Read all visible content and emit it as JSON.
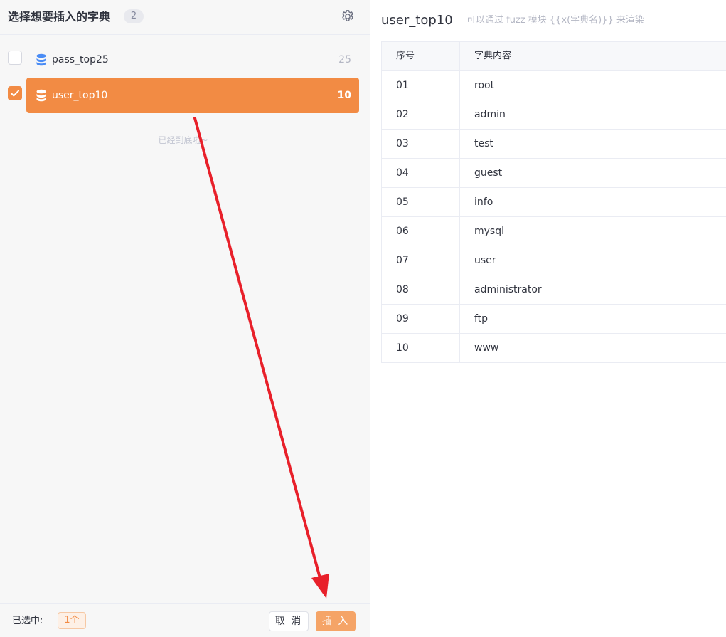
{
  "left_panel": {
    "title": "选择想要插入的字典",
    "count": "2",
    "settings_icon": "gear-icon",
    "items": [
      {
        "name": "pass_top25",
        "count": "25",
        "checked": false,
        "icon": "database-icon"
      },
      {
        "name": "user_top10",
        "count": "10",
        "checked": true,
        "icon": "database-icon"
      }
    ],
    "end_tip": "已经到底啦~",
    "footer": {
      "selected_label": "已选中:",
      "selected_count": "1个",
      "cancel_label": "取 消",
      "insert_label": "插 入"
    }
  },
  "right_panel": {
    "title": "user_top10",
    "hint": "可以通过 fuzz 模块 {{x(字典名)}} 来渲染",
    "columns": [
      "序号",
      "字典内容"
    ],
    "rows": [
      [
        "01",
        "root"
      ],
      [
        "02",
        "admin"
      ],
      [
        "03",
        "test"
      ],
      [
        "04",
        "guest"
      ],
      [
        "05",
        "info"
      ],
      [
        "06",
        "mysql"
      ],
      [
        "07",
        "user"
      ],
      [
        "08",
        "administrator"
      ],
      [
        "09",
        "ftp"
      ],
      [
        "10",
        "www"
      ]
    ]
  },
  "colors": {
    "accent": "#f28b44",
    "insert_button": "#f5a467",
    "arrow": "#e8202a"
  }
}
